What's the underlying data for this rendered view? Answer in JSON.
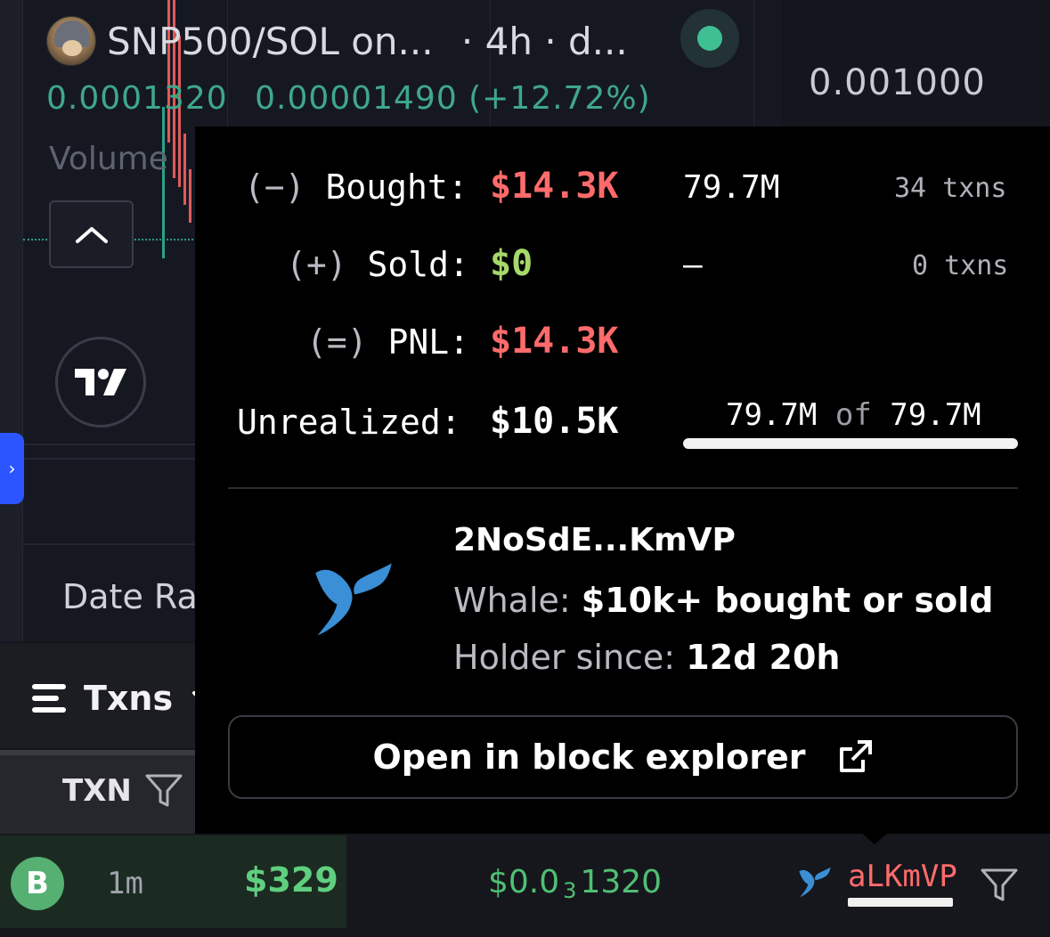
{
  "chart": {
    "pair_title": "SNP500/SOL on...",
    "meta": "· 4h · d...",
    "ohlc_price": "0.0001320",
    "ohlc_change": "0.00001490 (+12.72%)",
    "volume_label": "Volume",
    "axis_price": "0.001000",
    "date_range_label": "Date Ra"
  },
  "txns": {
    "title": "Txns",
    "column_txn": "TXN"
  },
  "popup": {
    "bought_op": "(−)",
    "bought_label": "Bought:",
    "bought_value": "$14.3K",
    "bought_amount": "79.7M",
    "bought_txns": "34 txns",
    "sold_op": "(+)",
    "sold_label": "Sold:",
    "sold_value": "$0",
    "sold_amount": "–",
    "sold_txns": "0 txns",
    "pnl_op": "(=)",
    "pnl_label": "PNL:",
    "pnl_value": "$14.3K",
    "unrealized_label": "Unrealized:",
    "unrealized_value": "$10.5K",
    "holding_amount": "79.7M",
    "holding_of": "of",
    "holding_total": "79.7M",
    "holding_fraction": 1.0,
    "address": "2NoSdE...KmVP",
    "whale_prefix": "Whale:",
    "whale_desc": "$10k+ bought or sold",
    "holder_prefix": "Holder since:",
    "holder_since": "12d 20h",
    "explorer_label": "Open in block explorer"
  },
  "row": {
    "type_badge": "B",
    "age": "1m",
    "usd": "$329",
    "price_prefix": "$0.0",
    "price_zeros": "3",
    "price_suffix": "1320",
    "maker": "aLKmVP"
  },
  "colors": {
    "buy_green": "#5fcf7f",
    "sell_red": "#ff6b6b",
    "accent_blue": "#2b56ff",
    "live_dot": "#3fbf92",
    "whale_blue": "#3a8fd6"
  },
  "icons": {
    "avatar": "cat-hoodie-avatar",
    "live": "live-status-dot",
    "collapse": "chevron-up-icon",
    "tradingview": "tradingview-logo",
    "side_toggle": "chevron-right-icon",
    "menu": "menu-lines-icon",
    "dropdown": "chevron-down-icon",
    "filter": "filter-icon",
    "whale": "whale-tail-icon",
    "external": "external-link-icon"
  }
}
